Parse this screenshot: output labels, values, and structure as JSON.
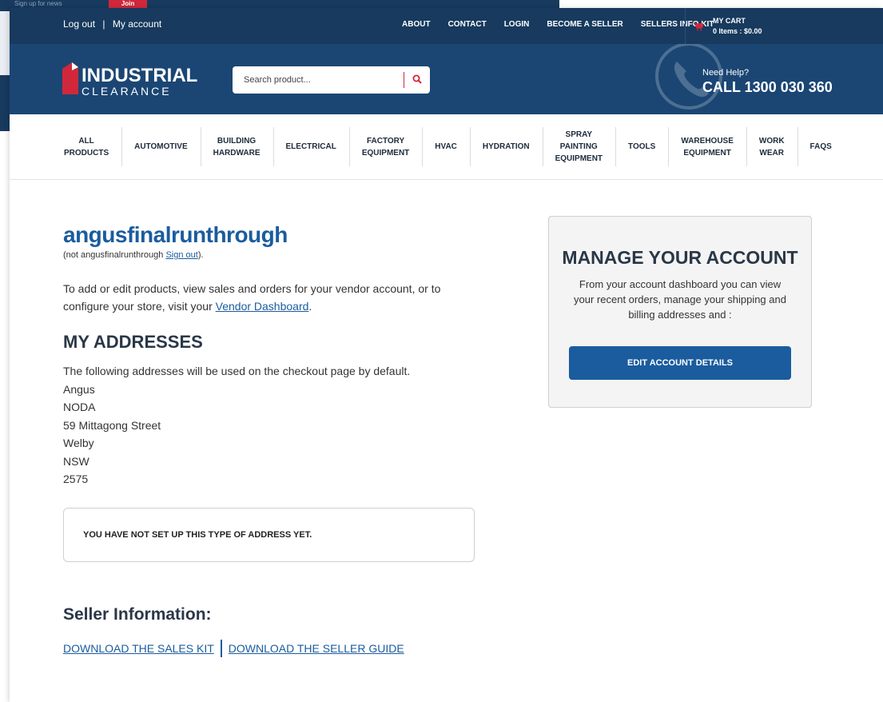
{
  "background": {
    "signup_text": "Sign up for news",
    "join_button": "Join"
  },
  "topbar": {
    "logout": "Log out",
    "separator": "|",
    "my_account": "My account",
    "nav": [
      "ABOUT",
      "CONTACT",
      "LOGIN",
      "BECOME A SELLER",
      "SELLERS INFO KIT"
    ],
    "cart_title": "MY CART",
    "cart_items": "0 Items : ",
    "cart_total": "$0.00"
  },
  "header": {
    "logo_line1": "INDUSTRIAL",
    "logo_line2": "CLEARANCE",
    "search_placeholder": "Search product...",
    "need_help": "Need Help?",
    "call": "CALL 1300 030 360"
  },
  "categories": [
    "ALL\nPRODUCTS",
    "AUTOMOTIVE",
    "BUILDING\nHARDWARE",
    "ELECTRICAL",
    "FACTORY\nEQUIPMENT",
    "HVAC",
    "HYDRATION",
    "SPRAY\nPAINTING\nEQUIPMENT",
    "TOOLS",
    "WAREHOUSE\nEQUIPMENT",
    "WORK\nWEAR",
    "FAQS"
  ],
  "account": {
    "username": "angusfinalrunthrough",
    "not_user_prefix": "(not angusfinalrunthrough ",
    "sign_out": "Sign out",
    "not_user_suffix": ").",
    "vendor_prefix": "To add or edit products, view sales and orders for your vendor account, or to configure your store, visit your ",
    "vendor_link": "Vendor Dashboard",
    "vendor_suffix": "."
  },
  "addresses": {
    "heading": "MY ADDRESSES",
    "intro": "The following addresses will be used on the checkout page by default.",
    "lines": [
      "Angus",
      "NODA",
      "59 Mittagong Street",
      "Welby",
      "NSW",
      "2575"
    ],
    "notice": "YOU HAVE NOT SET UP THIS TYPE OF ADDRESS YET."
  },
  "seller": {
    "heading": "Seller Information:",
    "sales_kit": "DOWNLOAD THE SALES KIT",
    "seller_guide": "DOWNLOAD THE SELLER GUIDE"
  },
  "manage": {
    "title": "MANAGE YOUR ACCOUNT",
    "description": "From your account dashboard you can view your recent orders, manage your shipping and billing addresses and :",
    "button": "EDIT ACCOUNT DETAILS"
  },
  "colors": {
    "navy": "#173a5e",
    "header_blue": "#1b4674",
    "link_blue": "#1b5c9e",
    "accent_red": "#d0283a"
  }
}
